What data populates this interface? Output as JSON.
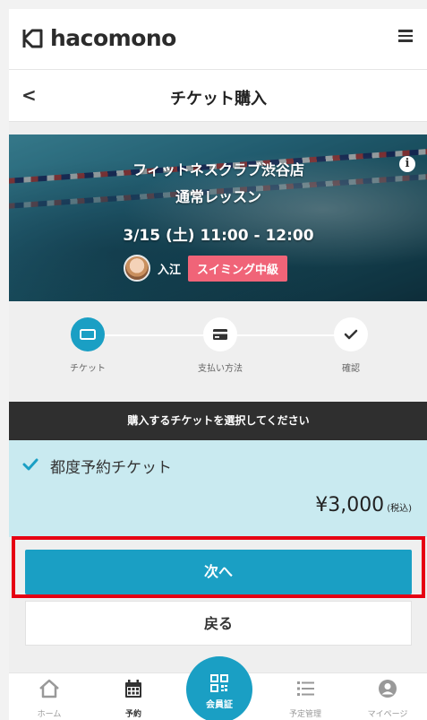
{
  "header": {
    "brand": "hacomono",
    "menu_icon": "hamburger-menu-icon"
  },
  "subheader": {
    "back_icon": "chevron-left-icon",
    "back_glyph": "<",
    "title": "チケット購入"
  },
  "hero": {
    "studio": "フィットネスクラブ渋谷店",
    "lesson": "通常レッスン",
    "schedule": "3/15 (土) 11:00 - 12:00",
    "instructor": "入江",
    "level": "スイミング中級",
    "info_icon": "info-icon"
  },
  "steps": [
    {
      "label": "チケット",
      "icon": "ticket-icon",
      "active": true
    },
    {
      "label": "支払い方法",
      "icon": "credit-card-icon",
      "active": false
    },
    {
      "label": "確認",
      "icon": "check-icon",
      "active": false
    }
  ],
  "prompt": "購入するチケットを選択してください",
  "ticket": {
    "selected": true,
    "name": "都度予約チケット",
    "price": "¥3,000",
    "tax_note": "(税込)"
  },
  "actions": {
    "next": "次へ",
    "back": "戻る"
  },
  "bottom_nav": {
    "items": [
      {
        "label": "ホーム",
        "icon": "home-icon"
      },
      {
        "label": "予約",
        "icon": "calendar-icon",
        "active": true
      },
      {
        "label": "予定管理",
        "icon": "list-icon"
      },
      {
        "label": "マイページ",
        "icon": "user-icon"
      }
    ],
    "member_card": {
      "label": "会員証",
      "icon": "qr-code-icon"
    }
  },
  "colors": {
    "accent": "#1a9fc4",
    "badge": "#f06478",
    "highlight": "#e60012",
    "ticket_bg": "#c9eaf0"
  }
}
